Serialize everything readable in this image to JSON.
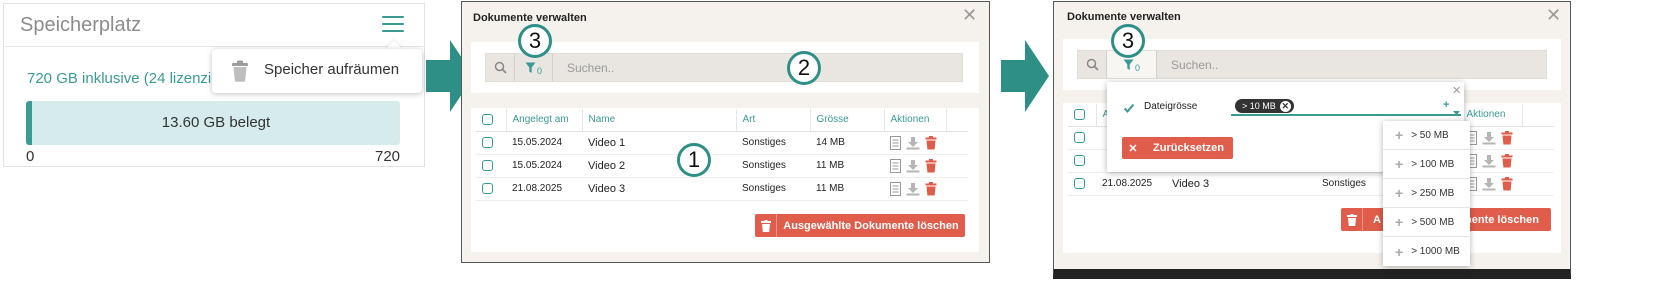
{
  "storage_widget": {
    "title": "Speicherplatz",
    "quota_text": "720 GB inklusive (24 lizenzi",
    "usage_label": "13.60 GB belegt",
    "usage_fraction": 0.019,
    "scale_min": "0",
    "scale_max": "720",
    "menu_item_label": "Speicher aufräumen"
  },
  "dialog": {
    "title": "Dokumente verwalten",
    "search_placeholder": "Suchen..",
    "filter_count": "0",
    "columns": [
      "Angelegt am",
      "Name",
      "Art",
      "Grösse",
      "Aktionen"
    ],
    "rows": [
      {
        "date": "15.05.2024",
        "name": "Video 1",
        "type": "Sonstiges",
        "size": "14 MB"
      },
      {
        "date": "15.05.2024",
        "name": "Video 2",
        "type": "Sonstiges",
        "size": "11 MB"
      },
      {
        "date": "21.08.2025",
        "name": "Video 3",
        "type": "Sonstiges",
        "size": "11 MB"
      }
    ],
    "delete_selected_label": "Ausgewählte Dokumente löschen",
    "close_glyph": "✕"
  },
  "callouts": {
    "table": "1",
    "search": "2",
    "filter": "3"
  },
  "filter_popover": {
    "field_label": "Dateigrösse",
    "active_chip": "> 10 MB",
    "chip_remove": "✕",
    "reset_label": "Zurücksetzen",
    "size_options": [
      "> 50 MB",
      "> 100 MB",
      "> 250 MB",
      "> 500 MB",
      "> 1000 MB"
    ],
    "delete_partial_label": "nente löschen",
    "delete_partial_letter": "A",
    "partial_header": "Aktionen",
    "partial_col_letter": "A"
  },
  "colors": {
    "accent": "#3a9a94",
    "danger": "#e05c4b",
    "dialog_bg": "#f5f2ee"
  }
}
